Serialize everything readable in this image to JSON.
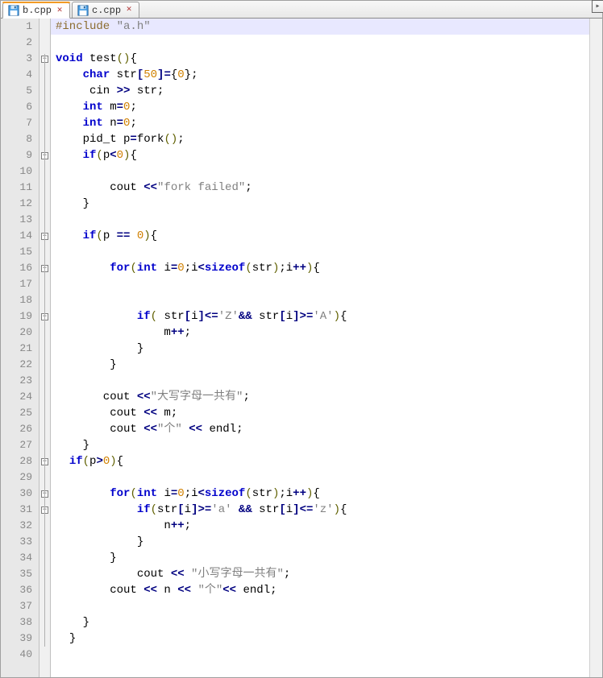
{
  "tabs": [
    {
      "label": "b.cpp",
      "active": true
    },
    {
      "label": "c.cpp",
      "active": false
    }
  ],
  "line_count": 40,
  "current_line": 1,
  "fold_markers": {
    "3": "minus",
    "9": "minus",
    "14": "minus",
    "16": "minus",
    "19": "minus",
    "28": "minus",
    "30": "minus",
    "31": "minus"
  },
  "code": {
    "l1": {
      "t0": "#include ",
      "t1": "\"a.h\""
    },
    "l2": {},
    "l3": {
      "t0": "void",
      "t1": " test",
      "t2": "()",
      "t3": "{"
    },
    "l4": {
      "t0": "    ",
      "t1": "char",
      "t2": " str",
      "t3": "[",
      "t4": "50",
      "t5": "]",
      "t6": "=",
      "t7": "{",
      "t8": "0",
      "t9": "}",
      "t10": ";"
    },
    "l5": {
      "t0": "     cin ",
      "t1": ">>",
      "t2": " str",
      "t3": ";"
    },
    "l6": {
      "t0": "    ",
      "t1": "int",
      "t2": " m",
      "t3": "=",
      "t4": "0",
      "t5": ";"
    },
    "l7": {
      "t0": "    ",
      "t1": "int",
      "t2": " n",
      "t3": "=",
      "t4": "0",
      "t5": ";"
    },
    "l8": {
      "t0": "    pid_t p",
      "t1": "=",
      "t2": "fork",
      "t3": "()",
      "t4": ";"
    },
    "l9": {
      "t0": "    ",
      "t1": "if",
      "t2": "(",
      "t3": "p",
      "t4": "<",
      "t5": "0",
      "t6": ")",
      "t7": "{"
    },
    "l10": {},
    "l11": {
      "t0": "        cout ",
      "t1": "<<",
      "t2": "\"fork failed\"",
      "t3": ";"
    },
    "l12": {
      "t0": "    ",
      "t1": "}"
    },
    "l13": {},
    "l14": {
      "t0": "    ",
      "t1": "if",
      "t2": "(",
      "t3": "p ",
      "t4": "==",
      "t5": " ",
      "t6": "0",
      "t7": ")",
      "t8": "{"
    },
    "l15": {},
    "l16": {
      "t0": "        ",
      "t1": "for",
      "t2": "(",
      "t3": "int",
      "t4": " i",
      "t5": "=",
      "t6": "0",
      "t7": ";",
      "t8": "i",
      "t9": "<",
      "t10": "sizeof",
      "t11": "(",
      "t12": "str",
      "t13": ")",
      "t14": ";",
      "t15": "i",
      "t16": "++",
      "t17": ")",
      "t18": "{"
    },
    "l17": {},
    "l18": {},
    "l19": {
      "t0": "            ",
      "t1": "if",
      "t2": "(",
      "t3": " str",
      "t4": "[",
      "t5": "i",
      "t6": "]",
      "t7": "<=",
      "t8": "'Z'",
      "t9": "&&",
      "t10": " str",
      "t11": "[",
      "t12": "i",
      "t13": "]",
      "t14": ">=",
      "t15": "'A'",
      "t16": ")",
      "t17": "{"
    },
    "l20": {
      "t0": "                m",
      "t1": "++",
      "t2": ";"
    },
    "l21": {
      "t0": "            ",
      "t1": "}"
    },
    "l22": {
      "t0": "        ",
      "t1": "}"
    },
    "l23": {},
    "l24": {
      "t0": "       cout ",
      "t1": "<<",
      "t2": "\"大写字母一共有\"",
      "t3": ";"
    },
    "l25": {
      "t0": "        cout ",
      "t1": "<<",
      "t2": " m",
      "t3": ";"
    },
    "l26": {
      "t0": "        cout ",
      "t1": "<<",
      "t2": "\"个\"",
      "t3": " ",
      "t4": "<<",
      "t5": " endl",
      "t6": ";"
    },
    "l27": {
      "t0": "    ",
      "t1": "}"
    },
    "l28": {
      "t0": "  ",
      "t1": "if",
      "t2": "(",
      "t3": "p",
      "t4": ">",
      "t5": "0",
      "t6": ")",
      "t7": "{"
    },
    "l29": {},
    "l30": {
      "t0": "        ",
      "t1": "for",
      "t2": "(",
      "t3": "int",
      "t4": " i",
      "t5": "=",
      "t6": "0",
      "t7": ";",
      "t8": "i",
      "t9": "<",
      "t10": "sizeof",
      "t11": "(",
      "t12": "str",
      "t13": ")",
      "t14": ";",
      "t15": "i",
      "t16": "++",
      "t17": ")",
      "t18": "{"
    },
    "l31": {
      "t0": "            ",
      "t1": "if",
      "t2": "(",
      "t3": "str",
      "t4": "[",
      "t5": "i",
      "t6": "]",
      "t7": ">=",
      "t8": "'a'",
      "t9": " ",
      "t10": "&&",
      "t11": " str",
      "t12": "[",
      "t13": "i",
      "t14": "]",
      "t15": "<=",
      "t16": "'z'",
      "t17": ")",
      "t18": "{"
    },
    "l32": {
      "t0": "                n",
      "t1": "++",
      "t2": ";"
    },
    "l33": {
      "t0": "            ",
      "t1": "}"
    },
    "l34": {
      "t0": "        ",
      "t1": "}"
    },
    "l35": {
      "t0": "            cout ",
      "t1": "<<",
      "t2": " ",
      "t3": "\"小写字母一共有\"",
      "t4": ";"
    },
    "l36": {
      "t0": "        cout ",
      "t1": "<<",
      "t2": " n ",
      "t3": "<<",
      "t4": " ",
      "t5": "\"个\"",
      "t6": "<<",
      "t7": " endl",
      "t8": ";"
    },
    "l37": {},
    "l38": {
      "t0": "    ",
      "t1": "}"
    },
    "l39": {
      "t0": "  ",
      "t1": "}"
    },
    "l40": {}
  },
  "line_numbers": {
    "n1": "1",
    "n2": "2",
    "n3": "3",
    "n4": "4",
    "n5": "5",
    "n6": "6",
    "n7": "7",
    "n8": "8",
    "n9": "9",
    "n10": "10",
    "n11": "11",
    "n12": "12",
    "n13": "13",
    "n14": "14",
    "n15": "15",
    "n16": "16",
    "n17": "17",
    "n18": "18",
    "n19": "19",
    "n20": "20",
    "n21": "21",
    "n22": "22",
    "n23": "23",
    "n24": "24",
    "n25": "25",
    "n26": "26",
    "n27": "27",
    "n28": "28",
    "n29": "29",
    "n30": "30",
    "n31": "31",
    "n32": "32",
    "n33": "33",
    "n34": "34",
    "n35": "35",
    "n36": "36",
    "n37": "37",
    "n38": "38",
    "n39": "39",
    "n40": "40"
  }
}
